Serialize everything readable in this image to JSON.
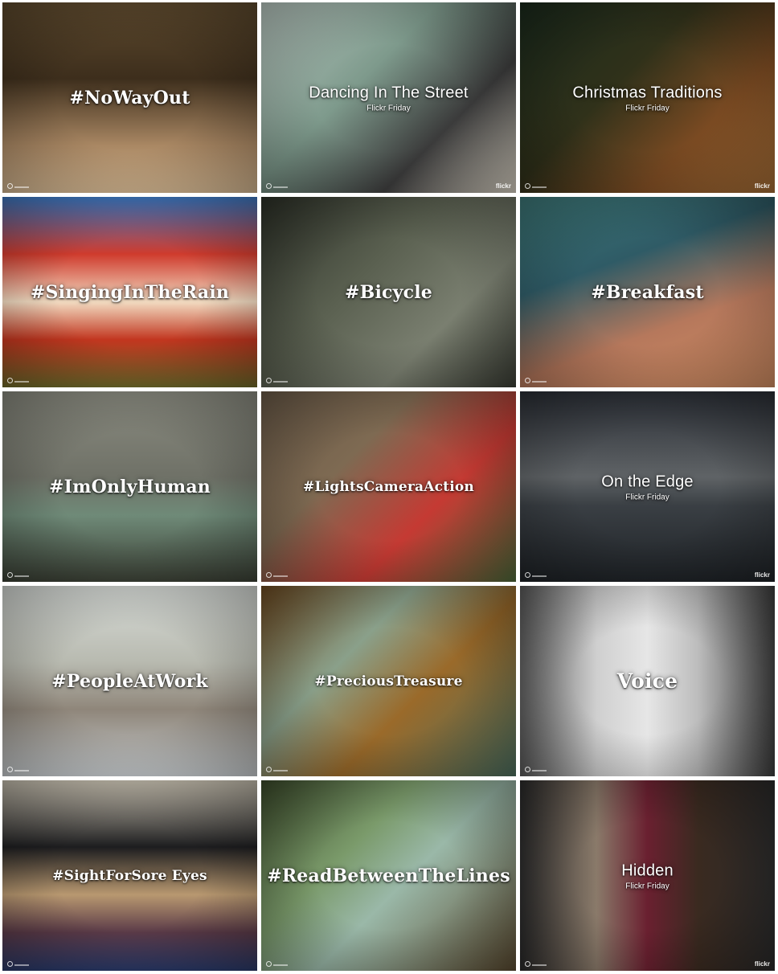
{
  "tiles": [
    {
      "title": "#NoWayOut",
      "subtitle": "",
      "badge": "",
      "style": "serif",
      "bg": "linear-gradient(180deg,#5e4a2e 0%,#3d2e1c 40%,#a98763 75%,#d5b892 100%)"
    },
    {
      "title": "Dancing In The Street",
      "subtitle": "Flickr Friday",
      "badge": "flickr",
      "style": "sans",
      "bg": "linear-gradient(135deg,#b8c7c0 0%,#7e9a8c 40%,#3b3b3b 70%,#d9d2c4 100%)"
    },
    {
      "title": "Christmas Traditions",
      "subtitle": "Flickr Friday",
      "badge": "flickr",
      "style": "sans",
      "bg": "linear-gradient(135deg,#1a2a1c 0%,#30311a 40%,#7a4a22 70%,#a66e37 100%)"
    },
    {
      "title": "#SingingInTheRain",
      "subtitle": "",
      "badge": "",
      "style": "serif",
      "bg": "linear-gradient(180deg,#3c7ac6 0%,#cf3b2d 30%,#f2dcc2 55%,#c2361f 75%,#6e6a2a 100%)"
    },
    {
      "title": "#Bicycle",
      "subtitle": "",
      "badge": "",
      "style": "serif",
      "bg": "linear-gradient(135deg,#2c3027 0%,#5a6050 40%,#7a7f70 70%,#3b3e35 100%)"
    },
    {
      "title": "#Breakfast",
      "subtitle": "",
      "badge": "",
      "style": "serif",
      "bg": "linear-gradient(160deg,#3e7a7a 0%,#2f5b66 35%,#b6785c 65%,#d28e63 100%)"
    },
    {
      "title": "#ImOnlyHuman",
      "subtitle": "",
      "badge": "",
      "style": "serif",
      "bg": "linear-gradient(180deg,#8a8b80 0%,#6f7167 45%,#6f8a78 65%,#3b4035 100%)"
    },
    {
      "title": "#LightsCameraAction",
      "subtitle": "",
      "badge": "",
      "style": "serif-small",
      "bg": "linear-gradient(135deg,#6a5a48 0%,#7e6a52 35%,#c53a33 65%,#4f6a3a 100%)"
    },
    {
      "title": "On the Edge",
      "subtitle": "Flickr Friday",
      "badge": "flickr",
      "style": "sans",
      "bg": "linear-gradient(180deg,#2a2e35 0%,#5f6366 45%,#3a3f44 60%,#1e2226 100%)"
    },
    {
      "title": "#PeopleAtWork",
      "subtitle": "",
      "badge": "",
      "style": "serif",
      "bg": "linear-gradient(180deg,#d8dcd8 0%,#b8bab0 40%,#8f867a 65%,#c8cdd0 100%)"
    },
    {
      "title": "#PreciousTreasure",
      "subtitle": "",
      "badge": "",
      "style": "serif-small",
      "bg": "linear-gradient(135deg,#6e4a20 0%,#8aa08a 35%,#9a6a2a 60%,#4d7060 100%)"
    },
    {
      "title": "Voice",
      "subtitle": "",
      "badge": "",
      "style": "serif-big",
      "bg": "linear-gradient(90deg,#5a5a5a 0%,#cfcfcf 30%,#e6e6e6 50%,#bcbcbc 70%,#3c3c3c 100%)"
    },
    {
      "title": "#SightForSore Eyes",
      "subtitle": "",
      "badge": "",
      "style": "serif-small",
      "bg": "linear-gradient(180deg,#c9c2b2 0%,#1d1d1f 35%,#b89870 60%,#5a3a48 80%,#2a3a6a 100%)"
    },
    {
      "title": "#ReadBetweenTheLines",
      "subtitle": "",
      "badge": "",
      "style": "serif",
      "bg": "linear-gradient(135deg,#3b4a2a 0%,#7a9a6a 35%,#9ab8a8 55%,#5a4a30 100%)"
    },
    {
      "title": "Hidden",
      "subtitle": "Flickr Friday",
      "badge": "flickr",
      "style": "sans",
      "bg": "linear-gradient(90deg,#2a2a2a 0%,#8a7a6a 30%,#6a2030 50%,#3a2a20 70%,#2a2a2a 100%)"
    }
  ]
}
